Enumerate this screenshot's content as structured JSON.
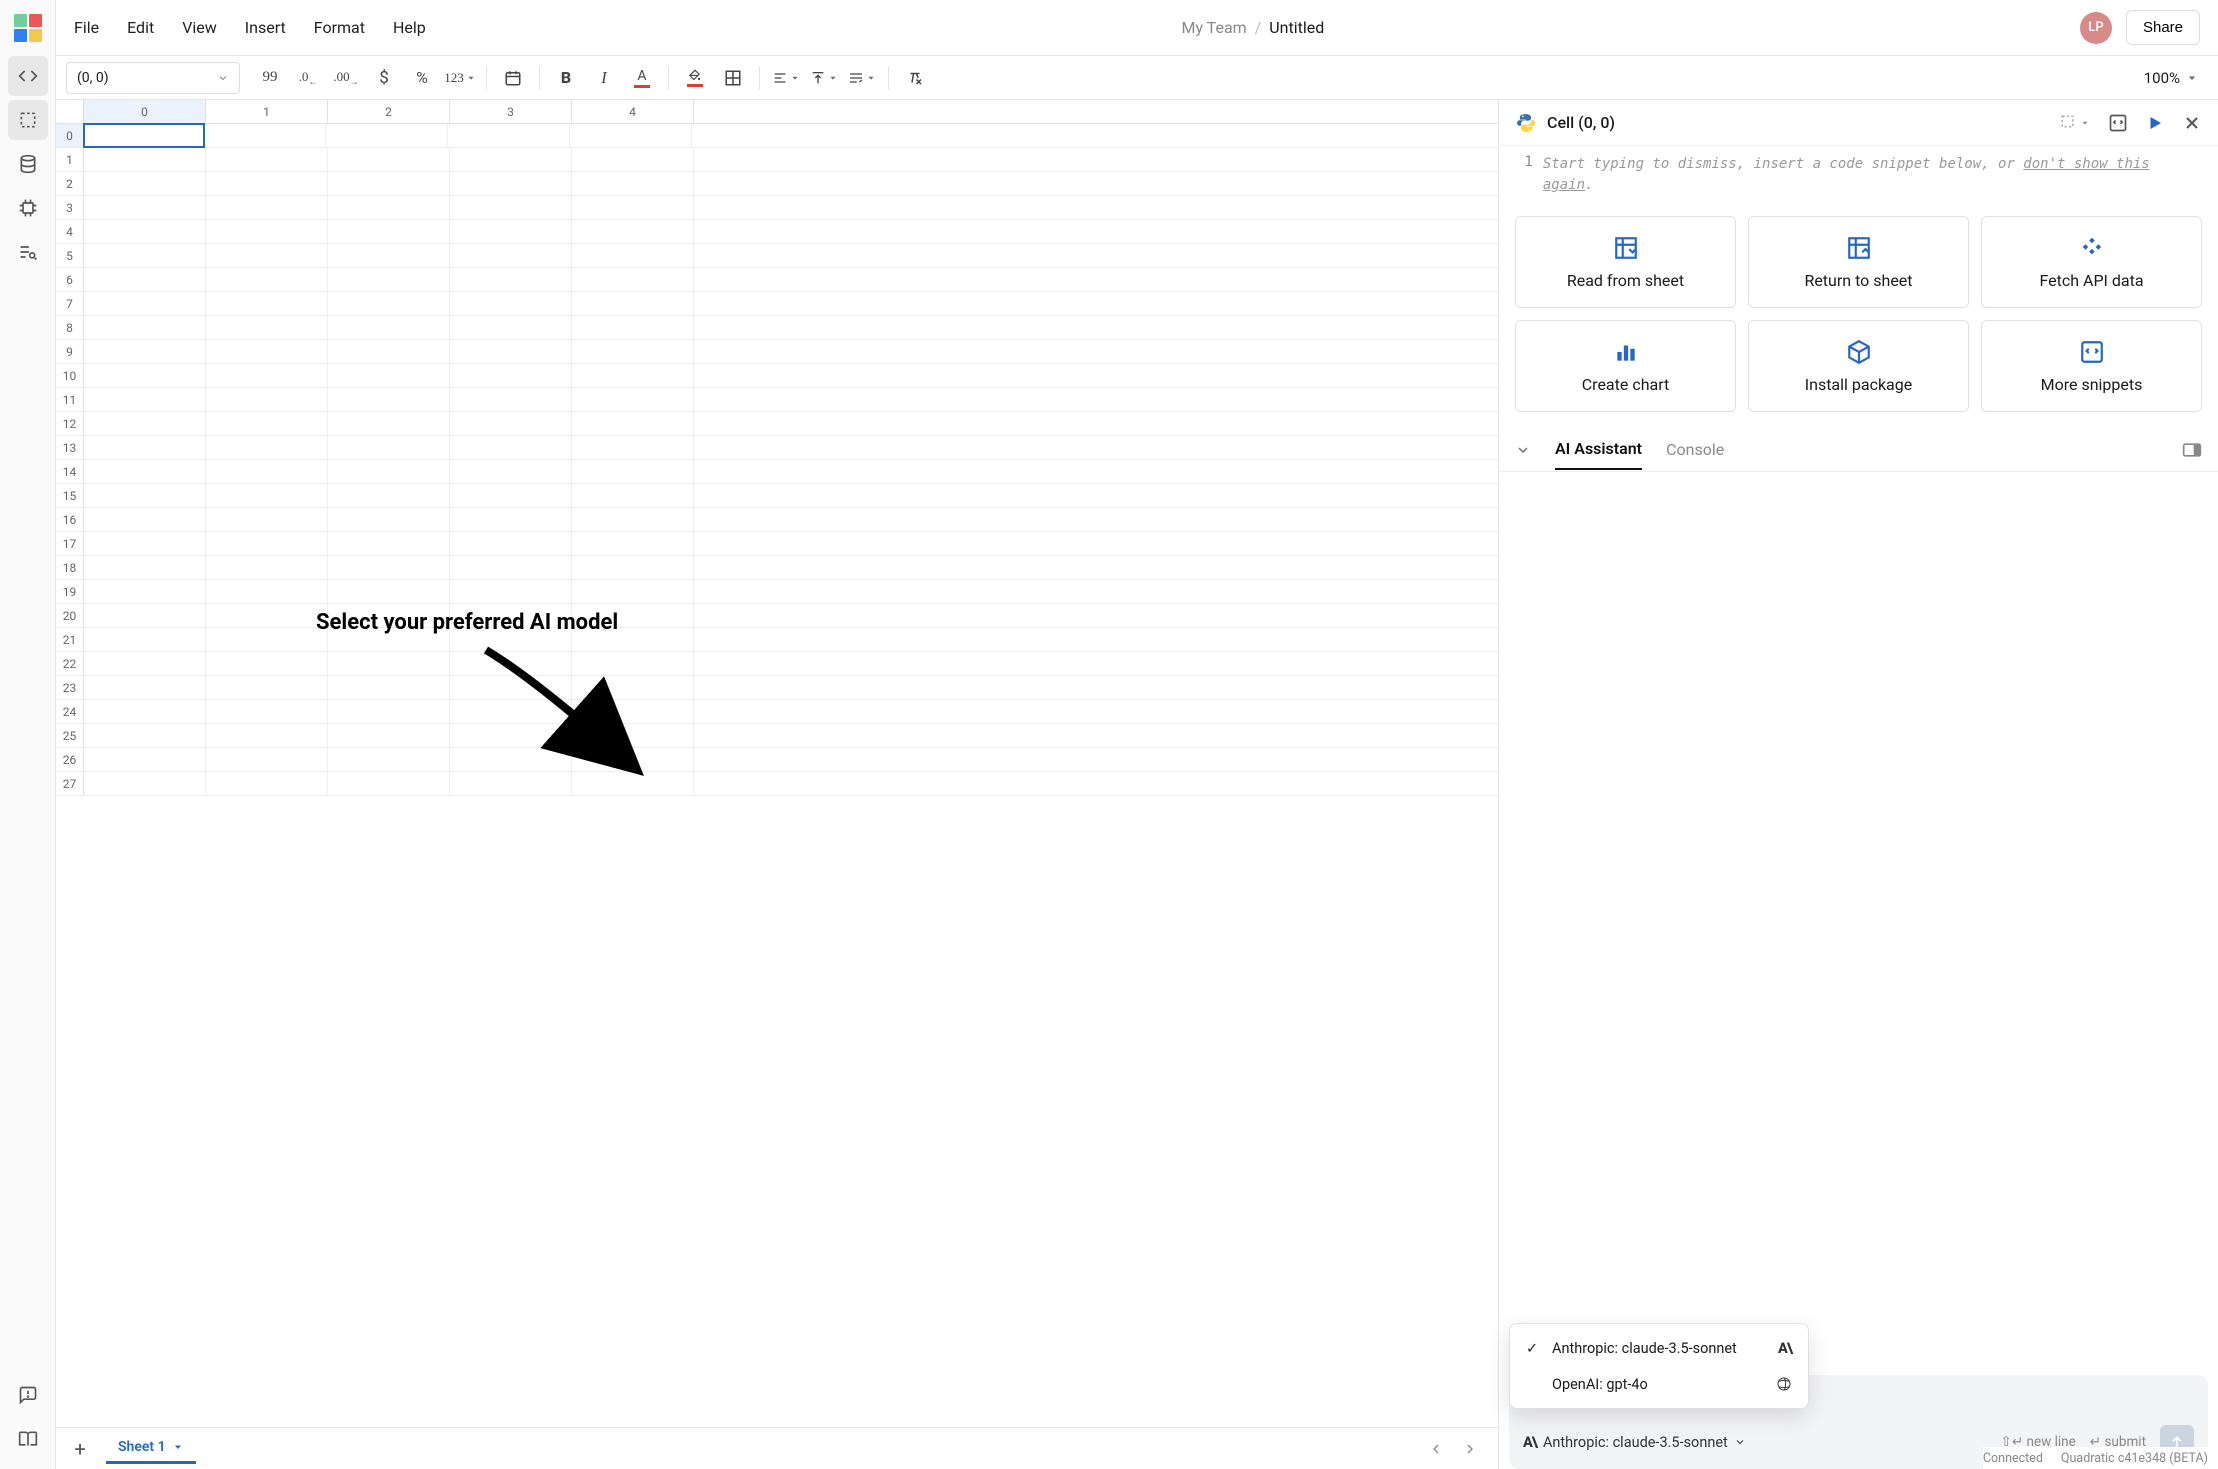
{
  "logo_colors": [
    "#6fcf97",
    "#eb5757",
    "#2f80ed",
    "#f2c94c"
  ],
  "menu": {
    "items": [
      "File",
      "Edit",
      "View",
      "Insert",
      "Format",
      "Help"
    ],
    "team": "My Team",
    "doc": "Untitled",
    "avatar": "LP",
    "share": "Share"
  },
  "toolbar": {
    "cell_ref": "(0, 0)",
    "num_format": "99",
    "dec_dec": ".0",
    "dec_inc": ".00",
    "num_type": "123",
    "zoom": "100%"
  },
  "grid": {
    "cols": [
      0,
      1,
      2,
      3,
      4
    ],
    "rows_count": 28,
    "selected_row": 0,
    "selected_col": 0
  },
  "sheet": {
    "add": "+",
    "name": "Sheet 1"
  },
  "panel": {
    "title": "Cell (0, 0)",
    "line_no": "1",
    "placeholder_a": "Start typing to dismiss, insert a code snippet below, or ",
    "placeholder_link": "don't show this again",
    "placeholder_b": ".",
    "snippets": [
      "Read from sheet",
      "Return to sheet",
      "Fetch API data",
      "Create chart",
      "Install package",
      "More snippets"
    ],
    "tabs": {
      "ai": "AI Assistant",
      "console": "Console"
    }
  },
  "annotation": "Select your preferred AI model",
  "models": {
    "items": [
      {
        "label": "Anthropic: claude-3.5-sonnet",
        "brand": "anthropic",
        "selected": true
      },
      {
        "label": "OpenAI: gpt-4o",
        "brand": "openai",
        "selected": false
      }
    ],
    "current": "Anthropic: claude-3.5-sonnet"
  },
  "prompt": {
    "newline": "new line",
    "submit": "submit"
  },
  "status": {
    "connected": "Connected",
    "version": "Quadratic c41e348 (BETA)"
  }
}
